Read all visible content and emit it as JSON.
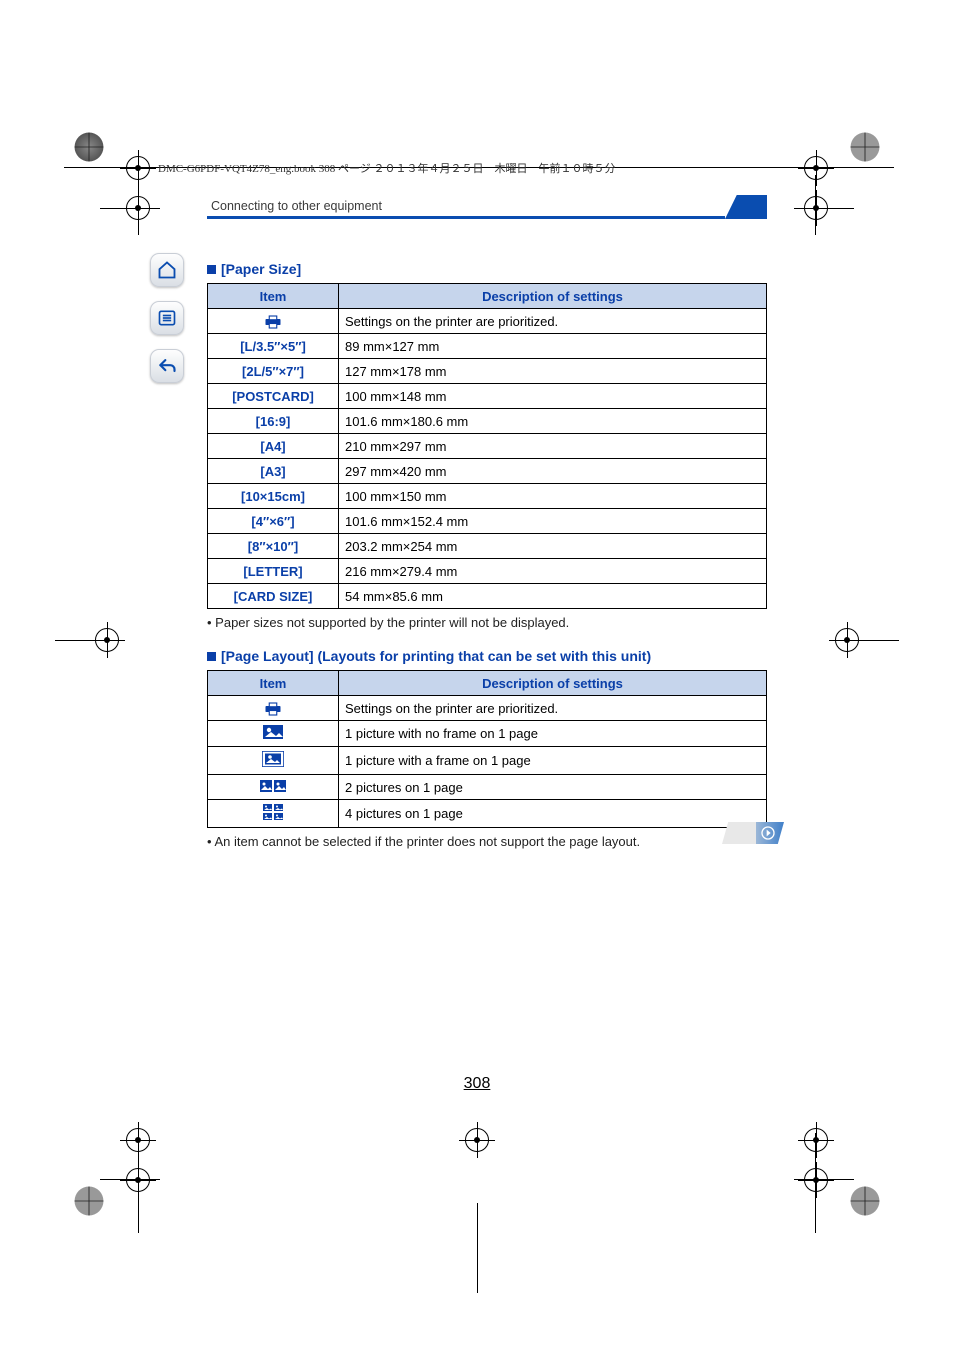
{
  "runhead": "DMC-G6PDF-VQT4Z78_eng.book  308 ページ  ２０１３年４月２５日　木曜日　午前１０時５分",
  "section_header": "Connecting to other equipment",
  "paper_size": {
    "heading": "[Paper Size]",
    "col_item": "Item",
    "col_desc": "Description of settings",
    "rows": [
      {
        "item_icon": "printer",
        "desc": "Settings on the printer are prioritized."
      },
      {
        "item": "[L/3.5″×5″]",
        "desc": "89 mm×127 mm"
      },
      {
        "item": "[2L/5″×7″]",
        "desc": "127 mm×178 mm"
      },
      {
        "item": "[POSTCARD]",
        "desc": "100 mm×148 mm"
      },
      {
        "item": "[16:9]",
        "desc": "101.6 mm×180.6 mm"
      },
      {
        "item": "[A4]",
        "desc": "210 mm×297 mm"
      },
      {
        "item": "[A3]",
        "desc": "297 mm×420 mm"
      },
      {
        "item": "[10×15cm]",
        "desc": "100 mm×150 mm"
      },
      {
        "item": "[4″×6″]",
        "desc": "101.6 mm×152.4 mm"
      },
      {
        "item": "[8″×10″]",
        "desc": "203.2 mm×254 mm"
      },
      {
        "item": "[LETTER]",
        "desc": "216 mm×279.4 mm"
      },
      {
        "item": "[CARD SIZE]",
        "desc": "54 mm×85.6 mm"
      }
    ],
    "note": "Paper sizes not supported by the printer will not be displayed."
  },
  "page_layout": {
    "heading": "[Page Layout] (Layouts for printing that can be set with this unit)",
    "col_item": "Item",
    "col_desc": "Description of settings",
    "rows": [
      {
        "icon": "printer",
        "desc": "Settings on the printer are prioritized."
      },
      {
        "icon": "noframe",
        "desc": "1 picture with no frame on 1 page"
      },
      {
        "icon": "frame",
        "desc": "1 picture with a frame on 1 page"
      },
      {
        "icon": "two",
        "desc": "2 pictures on 1 page"
      },
      {
        "icon": "four",
        "desc": "4 pictures on 1 page"
      }
    ],
    "note": "An item cannot be selected if the printer does not support the page layout."
  },
  "page_number": "308"
}
